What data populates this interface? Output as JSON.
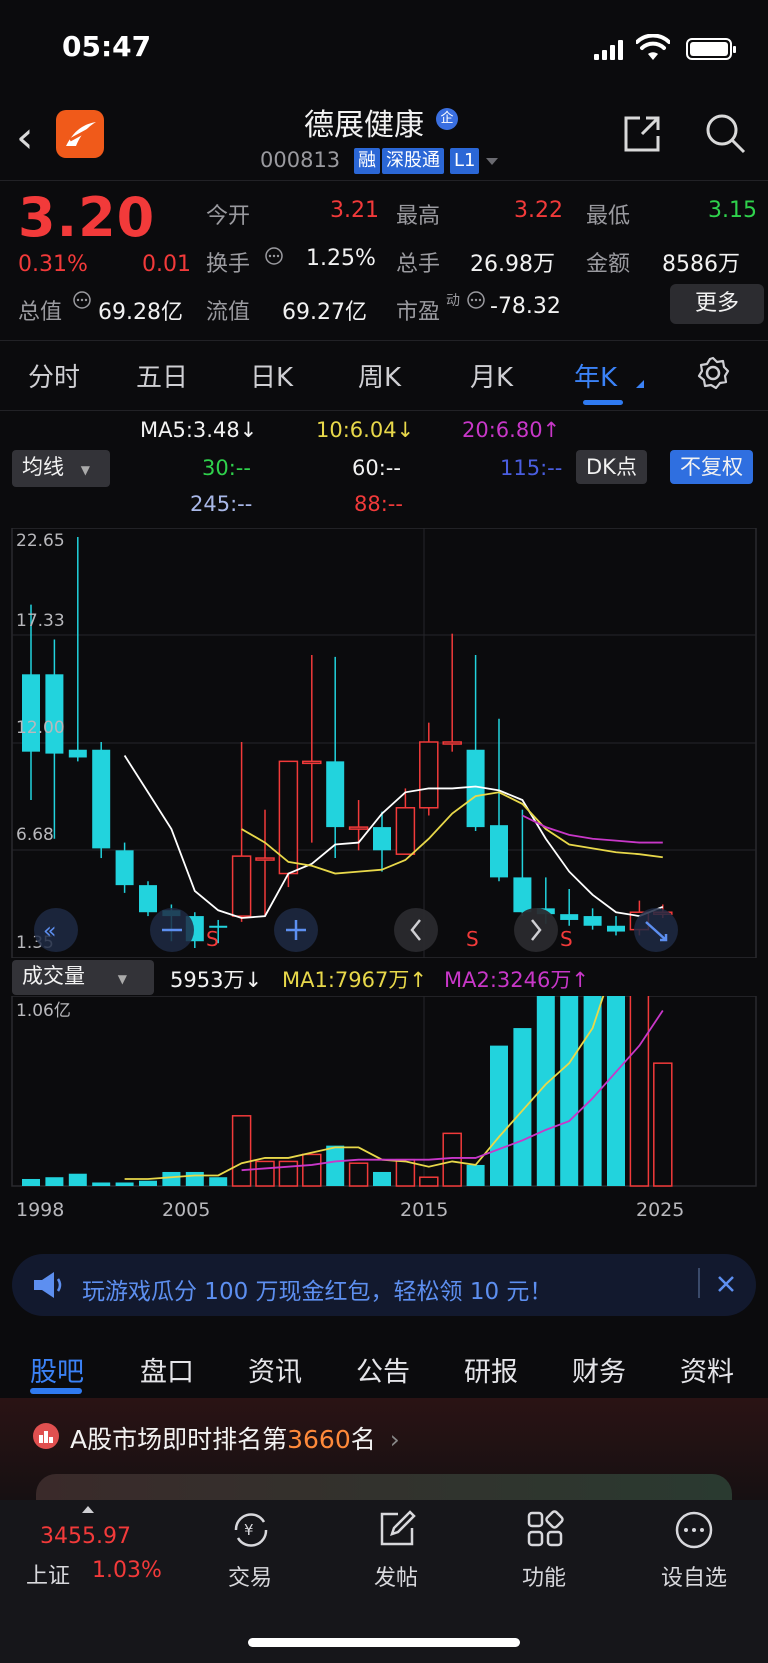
{
  "status": {
    "time": "05:47"
  },
  "header": {
    "title": "德展健康",
    "badge": "企",
    "code": "000813",
    "tags": [
      "融",
      "深股通",
      "L1"
    ]
  },
  "quote": {
    "price": "3.20",
    "change_pct": "0.31%",
    "change": "0.01",
    "open_label": "今开",
    "open": "3.21",
    "high_label": "最高",
    "high": "3.22",
    "low_label": "最低",
    "low": "3.15",
    "turnover_label": "换手",
    "turnover": "1.25%",
    "volume_label": "总手",
    "volume": "26.98万",
    "amount_label": "金额",
    "amount": "8586万",
    "mcap_label": "总值",
    "mcap": "69.28亿",
    "float_label": "流值",
    "float": "69.27亿",
    "pe_label": "市盈",
    "pe_sup": "动",
    "pe": "-78.32",
    "more_label": "更多"
  },
  "period_tabs": [
    "分时",
    "五日",
    "日K",
    "周K",
    "月K",
    "年K"
  ],
  "active_period": "年K",
  "ma_legend": {
    "ma5": "MA5:3.48↓",
    "ma10": "10:6.04↓",
    "ma20": "20:6.80↑",
    "ma30": "30:--",
    "ma60": "60:--",
    "ma115": "115:--",
    "ma245": "245:--",
    "ma88": "88:--",
    "indicator_select": "均线",
    "dk_label": "DK点",
    "adjust_label": "不复权"
  },
  "colors": {
    "up": "#f23a3a",
    "down": "#22d3dd",
    "ma5": "#ffffff",
    "ma10": "#e8d84a",
    "ma20": "#c837c8",
    "accent": "#2f7af0"
  },
  "price_axis": [
    "22.65",
    "17.33",
    "12.00",
    "6.68",
    "1.35"
  ],
  "signal_labels": [
    "S",
    "S",
    "S"
  ],
  "volume_legend": {
    "select": "成交量",
    "vol": "5953万↓",
    "ma1": "MA1:7967万↑",
    "ma2": "MA2:3246万↑",
    "axis_top": "1.06亿"
  },
  "x_axis": [
    "1998",
    "2005",
    "2015",
    "2025"
  ],
  "chart_data": {
    "type": "candlestick",
    "years": [
      1998,
      1999,
      2000,
      2001,
      2002,
      2003,
      2004,
      2005,
      2006,
      2007,
      2008,
      2009,
      2010,
      2011,
      2012,
      2013,
      2014,
      2015,
      2016,
      2017,
      2018,
      2019,
      2020,
      2021,
      2022,
      2023,
      2024,
      2025
    ],
    "open": [
      15.5,
      15.5,
      11.6,
      11.6,
      6.4,
      4.6,
      3.3,
      3.0,
      2.5,
      3.0,
      6.0,
      5.2,
      11.0,
      11.0,
      7.6,
      7.6,
      6.2,
      8.6,
      12.0,
      11.6,
      7.7,
      5.0,
      3.4,
      3.1,
      3.0,
      2.5,
      2.3,
      3.2
    ],
    "close": [
      11.5,
      11.4,
      11.2,
      6.5,
      4.6,
      3.2,
      3.0,
      1.7,
      2.4,
      6.1,
      6.0,
      11.0,
      11.0,
      7.6,
      7.6,
      6.4,
      8.6,
      12.0,
      12.0,
      7.6,
      5.0,
      3.2,
      3.1,
      2.8,
      2.5,
      2.2,
      3.2,
      3.2
    ],
    "high": [
      19.1,
      17.3,
      22.6,
      12.0,
      6.8,
      4.8,
      3.6,
      3.2,
      2.8,
      12.0,
      8.5,
      11.0,
      16.5,
      16.4,
      9.0,
      8.4,
      9.6,
      13.0,
      17.6,
      16.5,
      13.2,
      8.5,
      5.0,
      4.4,
      3.4,
      3.0,
      3.8,
      3.6
    ],
    "low": [
      9.0,
      7.0,
      11.0,
      6.0,
      4.2,
      3.0,
      1.7,
      1.35,
      1.6,
      2.7,
      3.0,
      4.5,
      6.8,
      6.0,
      6.4,
      5.3,
      6.2,
      8.2,
      11.5,
      7.4,
      4.8,
      3.0,
      2.6,
      2.5,
      2.3,
      2.0,
      2.0,
      2.9
    ],
    "volume": [
      4,
      5,
      7,
      2,
      2,
      3,
      8,
      8,
      5,
      40,
      14,
      14,
      18,
      23,
      13,
      8,
      15,
      5,
      30,
      12,
      80,
      90,
      110,
      120,
      160,
      210,
      220,
      70
    ],
    "ma5": [
      null,
      null,
      null,
      null,
      11.3,
      9.4,
      7.5,
      4.3,
      3.3,
      2.9,
      3.0,
      5.2,
      5.7,
      6.7,
      6.8,
      8.3,
      9.4,
      9.6,
      9.6,
      9.7,
      9.5,
      9.0,
      7.0,
      5.3,
      4.1,
      3.2,
      3.0,
      3.48
    ],
    "ma10": [
      null,
      null,
      null,
      null,
      null,
      null,
      null,
      null,
      null,
      7.5,
      6.8,
      5.8,
      5.6,
      5.2,
      5.3,
      5.4,
      5.9,
      7.0,
      8.3,
      9.2,
      9.4,
      8.8,
      7.5,
      6.7,
      6.5,
      6.3,
      6.2,
      6.04
    ],
    "ma20": [
      null,
      null,
      null,
      null,
      null,
      null,
      null,
      null,
      null,
      null,
      null,
      null,
      null,
      null,
      null,
      null,
      null,
      null,
      null,
      null,
      null,
      8.2,
      7.6,
      7.2,
      7.0,
      6.9,
      6.8,
      6.8
    ],
    "vol_ma1": [
      null,
      null,
      null,
      null,
      4,
      4,
      5,
      6,
      6,
      13,
      16,
      16,
      19,
      22,
      22,
      15,
      14,
      11,
      14,
      12,
      28,
      43,
      58,
      70,
      90,
      130,
      180,
      180
    ],
    "vol_ma2": [
      null,
      null,
      null,
      null,
      null,
      null,
      null,
      null,
      null,
      9,
      10,
      11,
      12,
      14,
      15,
      15,
      15,
      15,
      16,
      16,
      21,
      26,
      32,
      37,
      50,
      65,
      80,
      100
    ],
    "ylim": [
      1.35,
      22.65
    ],
    "vol_max": 106
  },
  "banner": {
    "text": "玩游戏瓜分 100 万现金红包，轻松领 10 元！"
  },
  "bottom_tabs": [
    "股吧",
    "盘口",
    "资讯",
    "公告",
    "研报",
    "财务",
    "资料"
  ],
  "rank": {
    "prefix": "A股市场即时排名第",
    "number": "3660",
    "suffix": "名"
  },
  "index": {
    "value": "3455.97",
    "name": "上证",
    "pct": "1.03%"
  },
  "nav": [
    "交易",
    "发帖",
    "功能",
    "设自选"
  ]
}
